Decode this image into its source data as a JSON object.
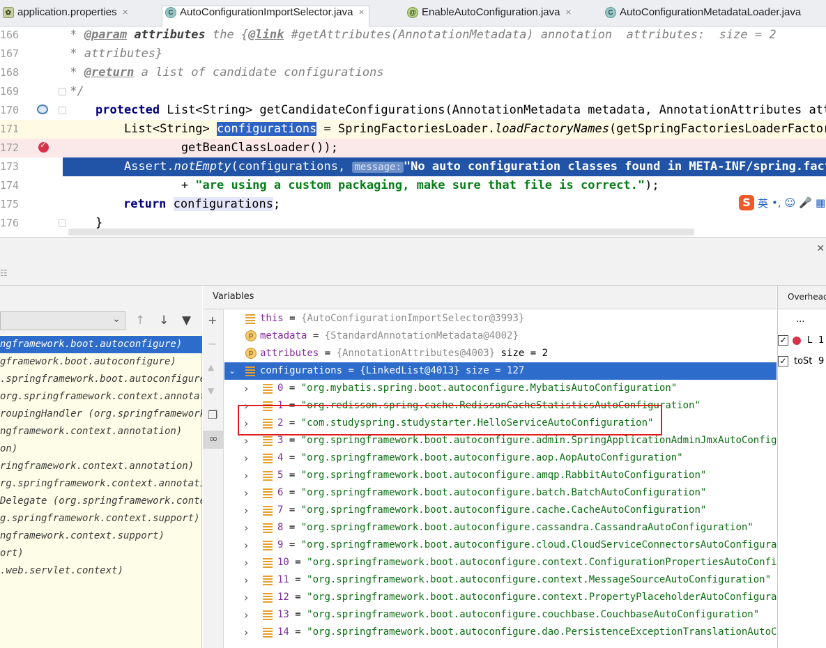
{
  "tabs": [
    {
      "label": "application.properties",
      "icon": "properties-file-icon",
      "active": false
    },
    {
      "label": "AutoConfigurationImportSelector.java",
      "icon": "class-icon",
      "active": true
    },
    {
      "label": "EnableAutoConfiguration.java",
      "icon": "annotation-icon",
      "active": false
    },
    {
      "label": "AutoConfigurationMetadataLoader.java",
      "icon": "class-icon",
      "active": false
    }
  ],
  "tab_close_glyph": "×",
  "editor": {
    "line_numbers": [
      "166",
      "167",
      "168",
      "169",
      "170",
      "171",
      "172",
      "173",
      "174",
      "175",
      "176"
    ],
    "lines": {
      "l166_star": " * ",
      "l166_tag": "@param",
      "l166_param": "attributes",
      "l166_rest1": " the {",
      "l166_link": "@link",
      "l166_rest2": " #getAttributes(AnnotationMetadata) annotation  attributes:  size = 2",
      "l167": " * attributes}",
      "l168_star": " * ",
      "l168_tag": "@return",
      "l168_rest": " a list of candidate configurations",
      "l169": " */",
      "l170_kw": "protected",
      "l170_rest": " List<String> getCandidateConfigurations(AnnotationMetadata metadata, AnnotationAttributes attri",
      "l171_a": "    List<String> ",
      "l171_var": "configurations",
      "l171_b": " = SpringFactoriesLoader.",
      "l171_c": "loadFactoryNames",
      "l171_d": "(getSpringFactoriesLoaderFactoryC",
      "l172": "            getBeanClassLoader());",
      "l173_a": "    Assert.",
      "l173_b": "notEmpty",
      "l173_c": "(configurations, ",
      "l173_hint": "message:",
      "l173_str": "\"No auto configuration classes found in META-INF/spring.fact",
      "l174_a": "            + ",
      "l174_str": "\"are using a custom packaging, make sure that file is correct.\"",
      "l174_b": ");",
      "l175_kw": "return",
      "l175_var": "configurations",
      "l175_b": ";",
      "l176": "}"
    }
  },
  "ime": {
    "logo": "S",
    "lang": "英",
    "punct": "•,",
    "emoji": "☺",
    "mic": "🎤",
    "grid": "▦"
  },
  "debugger": {
    "close_glyph": "✕",
    "toolbar_glyph": "☷",
    "frames": {
      "buttons": {
        "up": "↑",
        "down": "↓",
        "filter": "▼"
      },
      "chevron": "⌄",
      "items": [
        "ngframework.boot.autoconfigure)",
        "gframework.boot.autoconfigure)",
        ".springframework.boot.autoconfigure)",
        "org.springframework.context.annotati",
        "roupingHandler (org.springframework.",
        "ngframework.context.annotation)",
        "on)",
        "ringframework.context.annotation)",
        "rg.springframework.context.annotatio",
        "Delegate (org.springframework.contex",
        "g.springframework.context.support)",
        "ngframework.context.support)",
        "ort)",
        ".web.servlet.context)"
      ]
    },
    "variables": {
      "title": "Variables",
      "side_icons": {
        "add": "+",
        "remove": "−",
        "up": "▲",
        "down": "▼",
        "copy": "❐",
        "watch": "∞"
      },
      "rows": [
        {
          "kind": "field",
          "name": "this",
          "eq": " = ",
          "ref": "{AutoConfigurationImportSelector@3993}",
          "extra": ""
        },
        {
          "kind": "param",
          "name": "metadata",
          "eq": " = ",
          "ref": "{StandardAnnotationMetadata@4002}",
          "extra": ""
        },
        {
          "kind": "param",
          "name": "attributes",
          "eq": " = ",
          "ref": "{AnnotationAttributes@4003}",
          "extra": "  size = 2"
        },
        {
          "kind": "field",
          "name": "configurations",
          "eq": " = ",
          "ref": "{LinkedList@4013}",
          "extra": "  size = 127"
        }
      ],
      "items": [
        {
          "idx": "0",
          "val": "\"org.mybatis.spring.boot.autoconfigure.MybatisAutoConfiguration\""
        },
        {
          "idx": "1",
          "val": "\"org.redisson.spring.cache.RedissonCacheStatisticsAutoConfiguration\""
        },
        {
          "idx": "2",
          "val": "\"com.studyspring.studystarter.HelloServiceAutoConfiguration\""
        },
        {
          "idx": "3",
          "val": "\"org.springframework.boot.autoconfigure.admin.SpringApplicationAdminJmxAutoConfigurati"
        },
        {
          "idx": "4",
          "val": "\"org.springframework.boot.autoconfigure.aop.AopAutoConfiguration\""
        },
        {
          "idx": "5",
          "val": "\"org.springframework.boot.autoconfigure.amqp.RabbitAutoConfiguration\""
        },
        {
          "idx": "6",
          "val": "\"org.springframework.boot.autoconfigure.batch.BatchAutoConfiguration\""
        },
        {
          "idx": "7",
          "val": "\"org.springframework.boot.autoconfigure.cache.CacheAutoConfiguration\""
        },
        {
          "idx": "8",
          "val": "\"org.springframework.boot.autoconfigure.cassandra.CassandraAutoConfiguration\""
        },
        {
          "idx": "9",
          "val": "\"org.springframework.boot.autoconfigure.cloud.CloudServiceConnectorsAutoConfiguration\""
        },
        {
          "idx": "10",
          "val": "\"org.springframework.boot.autoconfigure.context.ConfigurationPropertiesAutoConfigurat"
        },
        {
          "idx": "11",
          "val": "\"org.springframework.boot.autoconfigure.context.MessageSourceAutoConfiguration\""
        },
        {
          "idx": "12",
          "val": "\"org.springframework.boot.autoconfigure.context.PropertyPlaceholderAutoConfiguration\""
        },
        {
          "idx": "13",
          "val": "\"org.springframework.boot.autoconfigure.couchbase.CouchbaseAutoConfiguration\""
        },
        {
          "idx": "14",
          "val": "\"org.springframework.boot.autoconfigure.dao.PersistenceExceptionTranslationAutoConfig"
        }
      ],
      "item_eq": " = ",
      "arrow_right": "›",
      "arrow_down": "⌄"
    },
    "overhead": {
      "title": "Overhead",
      "more": "...",
      "rows": [
        {
          "check": "✓",
          "label": "L",
          "value": "1"
        },
        {
          "check": "✓",
          "label": "toSt",
          "value": "9"
        }
      ]
    }
  }
}
